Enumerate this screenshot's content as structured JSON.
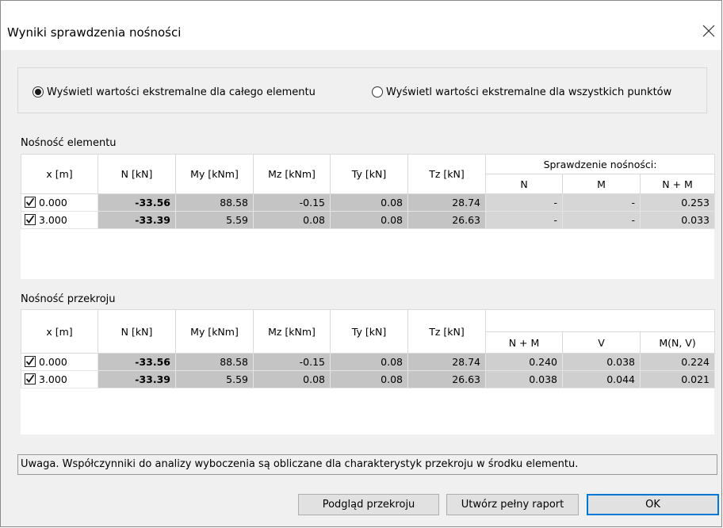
{
  "window": {
    "title": "Wyniki sprawdzenia nośności"
  },
  "radio_options": [
    {
      "label": "Wyświetl wartości ekstremalne dla całego elementu",
      "selected": true
    },
    {
      "label": "Wyświetl wartości ekstremalne dla wszystkich punktów",
      "selected": false
    }
  ],
  "element_section": {
    "label": "Nośność elementu",
    "headers": {
      "x": "x [m]",
      "n": "N [kN]",
      "my": "My [kNm]",
      "mz": "Mz [kNm]",
      "ty": "Ty [kN]",
      "tz": "Tz [kN]",
      "group": "Sprawdzenie nośności:",
      "c1": "N",
      "c2": "M",
      "c3": "N + M"
    },
    "rows": [
      {
        "x": "0.000",
        "checked": true,
        "n": "-33.56",
        "my": "88.58",
        "mz": "-0.15",
        "ty": "0.08",
        "tz": "28.74",
        "c1": "-",
        "c2": "-",
        "c3": "0.253"
      },
      {
        "x": "3.000",
        "checked": true,
        "n": "-33.39",
        "my": "5.59",
        "mz": "0.08",
        "ty": "0.08",
        "tz": "26.63",
        "c1": "-",
        "c2": "-",
        "c3": "0.033"
      }
    ]
  },
  "section_section": {
    "label": "Nośność przekroju",
    "headers": {
      "x": "x [m]",
      "n": "N [kN]",
      "my": "My [kNm]",
      "mz": "Mz [kNm]",
      "ty": "Ty [kN]",
      "tz": "Tz [kN]",
      "group": "",
      "c1": "N + M",
      "c2": "V",
      "c3": "M(N, V)"
    },
    "rows": [
      {
        "x": "0.000",
        "checked": true,
        "n": "-33.56",
        "my": "88.58",
        "mz": "-0.15",
        "ty": "0.08",
        "tz": "28.74",
        "c1": "0.240",
        "c2": "0.038",
        "c3": "0.224"
      },
      {
        "x": "3.000",
        "checked": true,
        "n": "-33.39",
        "my": "5.59",
        "mz": "0.08",
        "ty": "0.08",
        "tz": "26.63",
        "c1": "0.038",
        "c2": "0.044",
        "c3": "0.021"
      }
    ]
  },
  "note": "Uwaga. Współczynniki do analizy wyboczenia są obliczane dla charakterystyk przekroju w środku elementu.",
  "buttons": {
    "preview": "Podgląd przekroju",
    "report": "Utwórz pełny raport",
    "ok": "OK"
  },
  "colors": {
    "accent": "#0078d7",
    "cell_gray": "#c4c4c4"
  },
  "icons": {
    "close": "close-icon",
    "checkbox": "checkbox-checked-icon"
  }
}
